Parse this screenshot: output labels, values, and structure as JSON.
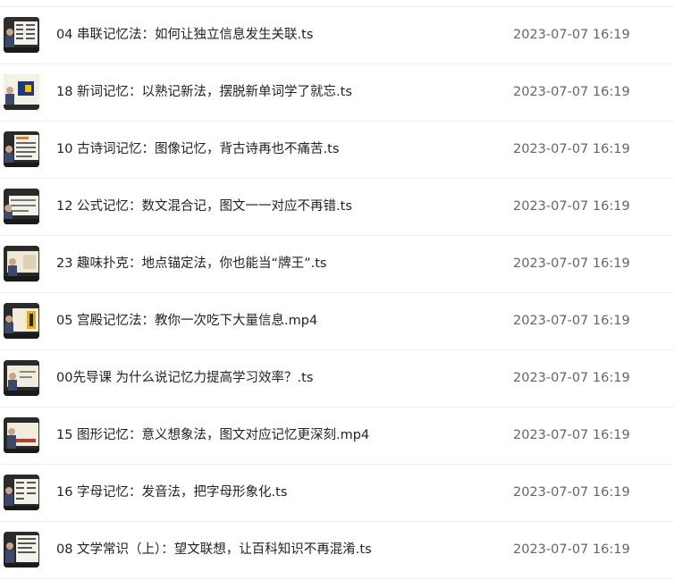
{
  "files": [
    {
      "name": "04 串联记忆法：如何让独立信息发生关联.ts",
      "modified": "2023-07-07 16:19"
    },
    {
      "name": "18 新词记忆：以熟记新法，摆脱新单词学了就忘.ts",
      "modified": "2023-07-07 16:19"
    },
    {
      "name": "10 古诗词记忆：图像记忆，背古诗再也不痛苦.ts",
      "modified": "2023-07-07 16:19"
    },
    {
      "name": "12 公式记忆：数文混合记，图文一一对应不再错.ts",
      "modified": "2023-07-07 16:19"
    },
    {
      "name": "23 趣味扑克：地点锚定法，你也能当“牌王”.ts",
      "modified": "2023-07-07 16:19"
    },
    {
      "name": "05 宫殿记忆法：教你一次吃下大量信息.mp4",
      "modified": "2023-07-07 16:19"
    },
    {
      "name": "00先导课 为什么说记忆力提高学习效率？.ts",
      "modified": "2023-07-07 16:19"
    },
    {
      "name": "15 图形记忆：意义想象法，图文对应记忆更深刻.mp4",
      "modified": "2023-07-07 16:19"
    },
    {
      "name": "16 字母记忆：发音法，把字母形象化.ts",
      "modified": "2023-07-07 16:19"
    },
    {
      "name": "08 文学常识（上）：望文联想，让百科知识不再混淆.ts",
      "modified": "2023-07-07 16:19"
    }
  ]
}
